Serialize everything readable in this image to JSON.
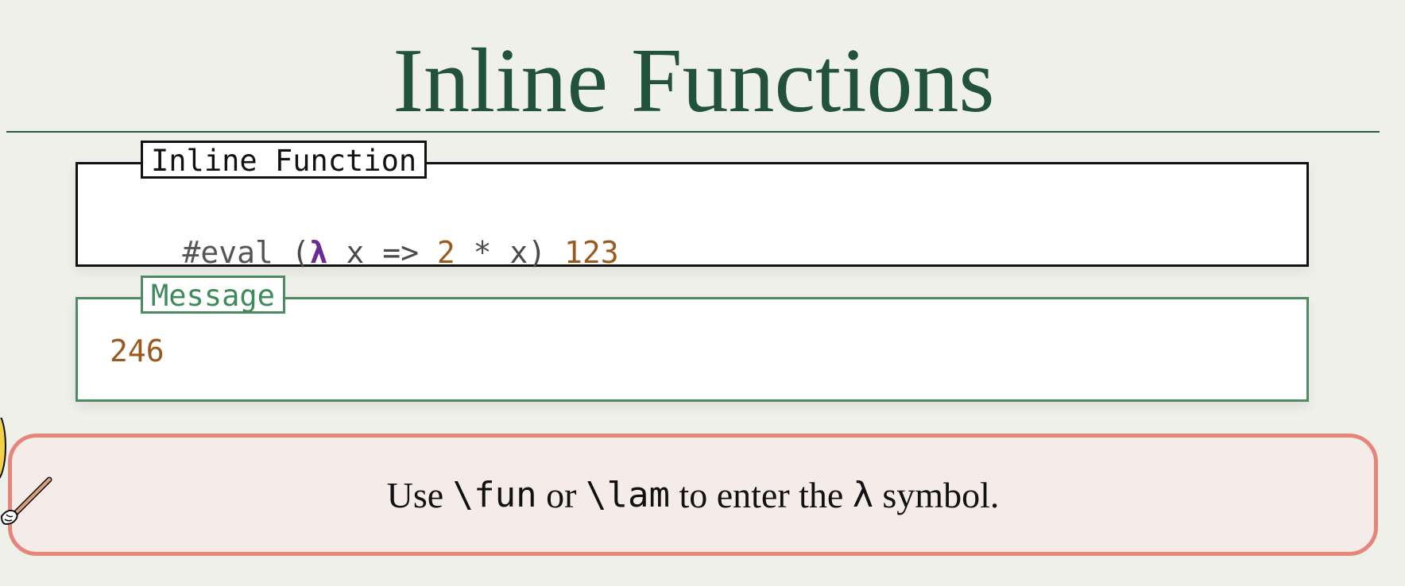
{
  "page": {
    "title": "Inline Functions"
  },
  "code_panel": {
    "label": "Inline Function",
    "code_tokens": [
      {
        "text": "#eval",
        "kind": "kw"
      },
      {
        "text": " (",
        "kind": "plain"
      },
      {
        "text": "λ",
        "kind": "lambda"
      },
      {
        "text": " x => ",
        "kind": "plain"
      },
      {
        "text": "2",
        "kind": "num"
      },
      {
        "text": " * x) ",
        "kind": "plain"
      },
      {
        "text": "123",
        "kind": "num"
      }
    ]
  },
  "message_panel": {
    "label": "Message",
    "value": "246"
  },
  "tip": {
    "part1": "Use ",
    "code1": "\\fun",
    "part2": " or ",
    "code2": "\\lam",
    "part3": " to enter the ",
    "symbol": "λ",
    "part4": " symbol."
  },
  "colors": {
    "background": "#f0f0eb",
    "title": "#22523b",
    "code_border": "#111111",
    "message_border": "#4e8a62",
    "number": "#9a5a1e",
    "lambda": "#6a2a94",
    "tip_border": "#e6867a",
    "tip_background": "#f5ecea"
  },
  "icons": {
    "mascot": "pointer-mascot-icon"
  }
}
